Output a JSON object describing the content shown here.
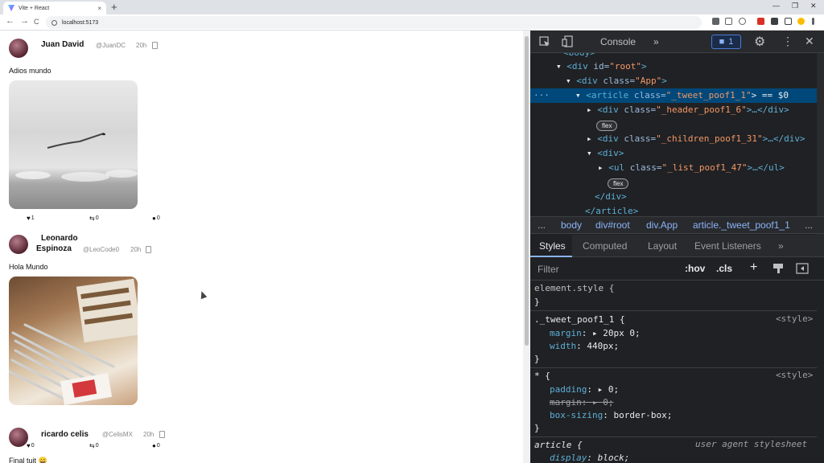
{
  "browser": {
    "tab_title": "Vite + React",
    "tab_close": "×",
    "new_tab": "+",
    "url": "localhost:5173",
    "window_controls": [
      "—",
      "❐",
      "✕"
    ],
    "nav_back": "←",
    "nav_forward": "→",
    "nav_reload": "C"
  },
  "tweets": [
    {
      "name": "Juan David",
      "handle": "@JuanDC",
      "time": "20h",
      "text": "Adios mundo",
      "likes": "1",
      "retweets": "0",
      "comments": "0"
    },
    {
      "name_line1": "Leonardo",
      "name_line2": "Espinoza",
      "handle": "@LeoCode0",
      "time": "20h",
      "text": "Hola Mundo",
      "likes": "0",
      "retweets": "0",
      "comments": "0"
    },
    {
      "name": "ricardo celis",
      "handle": "@CelisMX",
      "time": "20h",
      "text": "Final tuit 😄"
    }
  ],
  "icons": {
    "like": "♥",
    "retweet": "⇆",
    "comment": "●"
  },
  "devtools": {
    "console_tab": "Console",
    "more_tabs": "»",
    "issues_count": "1",
    "settings": "⚙",
    "menu": "⋮",
    "close": "✕",
    "dom": {
      "line0": "<body>",
      "line1_tag": "<div ",
      "line1_attr": "id=",
      "line1_val": "\"root\"",
      "line1_end": ">",
      "line2_tag": "<div ",
      "line2_attr": "class=",
      "line2_val": "\"App\"",
      "line2_end": ">",
      "line3_tag": "<article ",
      "line3_attr": "class=",
      "line3_val": "\"_tweet_poof1_1\"",
      "line3_end": "> == $0",
      "line4_tag": "<div ",
      "line4_attr": "class=",
      "line4_val": "\"_header_poof1_6\"",
      "line4_end": ">…</div>",
      "line5_tag": "<div ",
      "line5_attr": "class=",
      "line5_val": "\"_children_poof1_31\"",
      "line5_end": ">…</div>",
      "line6": "<div>",
      "line7_tag": "<ul ",
      "line7_attr": "class=",
      "line7_val": "\"_list_poof1_47\"",
      "line7_end": ">…</ul>",
      "line8": "</div>",
      "line9": "</article>",
      "flex_badge": "flex",
      "dots": "···"
    },
    "breadcrumbs": [
      "...",
      "body",
      "div#root",
      "div.App",
      "article._tweet_poof1_1"
    ],
    "panes": [
      "Styles",
      "Computed",
      "Layout",
      "Event Listeners",
      "»"
    ],
    "filter_placeholder": "Filter",
    "hov": ":hov",
    "cls": ".cls",
    "plus": "+",
    "styles": {
      "element_style": "element.style {",
      "close_brace": "}",
      "rule1_selector": "._tweet_poof1_1 {",
      "rule1_source": "<style>",
      "rule1_p1_name": "margin",
      "rule1_p1_val": "▸ 20px 0;",
      "rule1_p2_name": "width",
      "rule1_p2_val": " 440px;",
      "rule2_selector": "* {",
      "rule2_source": "<style>",
      "rule2_p1_name": "padding",
      "rule2_p1_val": "▸ 0;",
      "rule2_p2": "margin: ▸ 0;",
      "rule2_p3_name": "box-sizing",
      "rule2_p3_val": " border-box;",
      "rule3_selector": "article {",
      "rule3_source": "user agent stylesheet",
      "rule3_p1_name": "display",
      "rule3_p1_val": " block;"
    }
  }
}
